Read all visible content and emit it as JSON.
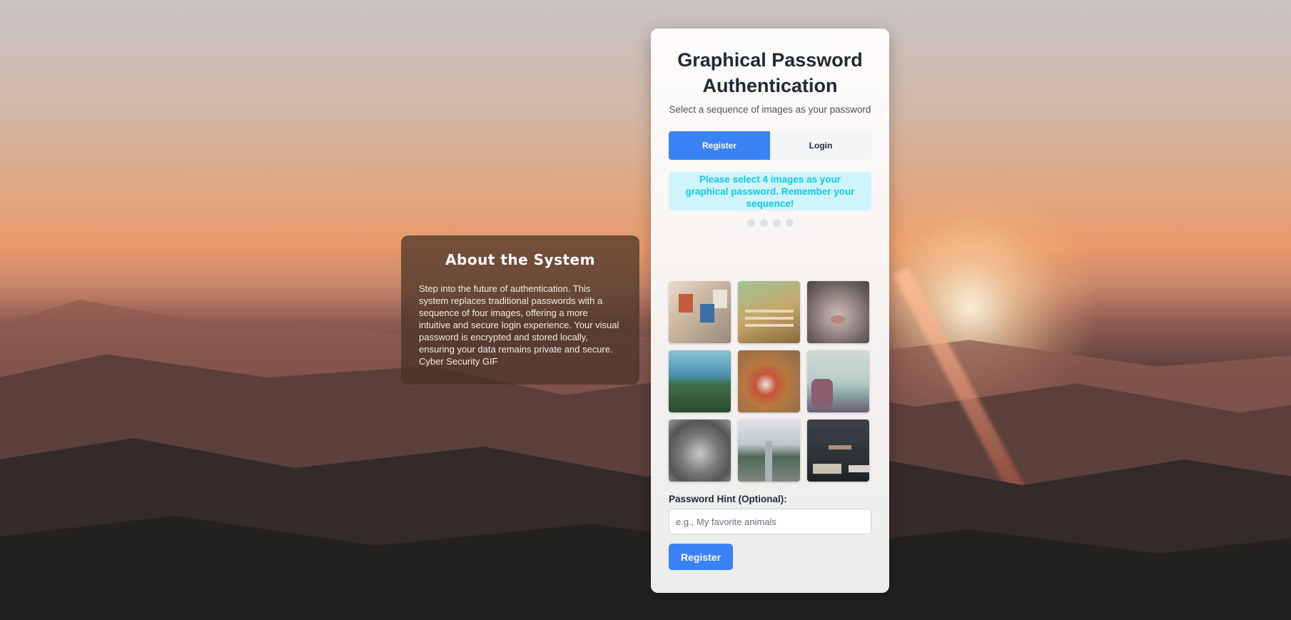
{
  "about": {
    "title": "About the System",
    "body": "Step into the future of authentication. This system replaces traditional passwords with a sequence of four images, offering a more intuitive and secure login experience. Your visual password is encrypted and stored locally, ensuring your data remains private and secure. Cyber Security GIF"
  },
  "card": {
    "title": "Graphical Password Authentication",
    "subtitle": "Select a sequence of images as your password",
    "tabs": [
      {
        "label": "Register",
        "active": true
      },
      {
        "label": "Login",
        "active": false
      }
    ],
    "notice": "Please select 4 images as your graphical password. Remember your sequence!",
    "selected_count": 0,
    "total_required": 4,
    "images": [
      {
        "icon": "desk-flatlay-image"
      },
      {
        "icon": "garden-fence-image"
      },
      {
        "icon": "cat-nose-image"
      },
      {
        "icon": "forest-lake-image"
      },
      {
        "icon": "coffee-mug-image"
      },
      {
        "icon": "beach-pier-image"
      },
      {
        "icon": "pine-cones-image"
      },
      {
        "icon": "tree-road-image"
      },
      {
        "icon": "workspace-keyboard-image"
      }
    ],
    "hint_label": "Password Hint (Optional):",
    "hint_placeholder": "e.g., My favorite animals",
    "hint_value": "",
    "submit_label": "Register"
  },
  "colors": {
    "accent": "#3b82f6",
    "notice_bg": "#cff4fc",
    "notice_text": "#0dcaf0"
  }
}
